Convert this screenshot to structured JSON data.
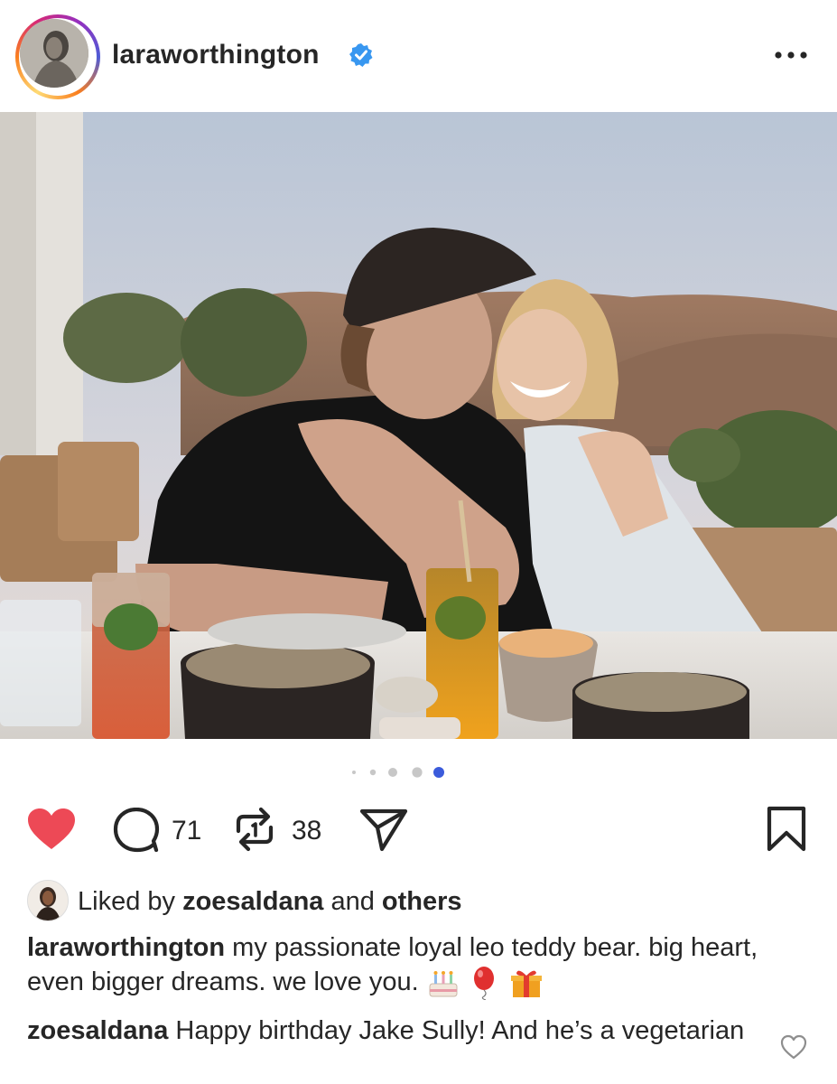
{
  "post": {
    "author": {
      "username": "laraworthington",
      "verified": true,
      "avatar_icon": "profile-photo"
    },
    "more_icon": "more-horizontal-icon",
    "photo": {
      "description_icon": "post-photo",
      "carousel": {
        "total": 5,
        "active_index": 4
      }
    },
    "actions": {
      "like_icon": "heart-filled-icon",
      "liked": true,
      "comment_icon": "comment-icon",
      "comment_count": "71",
      "repost_icon": "repost-icon",
      "repost_count": "38",
      "share_icon": "send-icon",
      "save_icon": "bookmark-icon"
    },
    "likes": {
      "prefix": "Liked by ",
      "user": "zoesaldana",
      "middle": " and ",
      "others": "others"
    },
    "caption": {
      "username": "laraworthington",
      "text": " my passionate loyal leo teddy bear. big heart, even bigger dreams. we love you. ",
      "emojis": [
        "birthday-cake-emoji",
        "balloon-emoji",
        "gift-emoji"
      ]
    },
    "top_comment": {
      "username": "zoesaldana",
      "text": " Happy birthday Jake Sully! And he’s a vegetarian",
      "heart_icon": "heart-outline-icon"
    }
  },
  "colors": {
    "like_red": "#ed4956",
    "verified_blue": "#3897f0",
    "carousel_active": "#3b5bdb",
    "text": "#262626"
  }
}
